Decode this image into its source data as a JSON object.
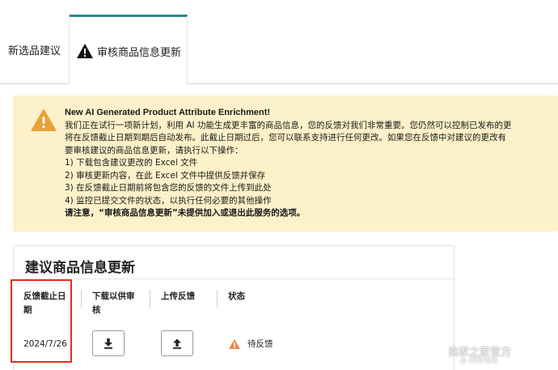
{
  "tabs": [
    {
      "label": "新选品建议"
    },
    {
      "label": "审核商品信息更新"
    }
  ],
  "alert": {
    "title": "New AI Generated Product Attribute Enrichment!",
    "lines": [
      "我们正在试行一项新计划，利用 AI 功能生成更丰富的商品信息，您的反馈对我们非常重要。您仍然可以控制已发布的更",
      "将在反馈截止日期到期后自动发布。此截止日期过后，您可以联系支持进行任何更改。如果您在反馈中对建议的更改有",
      "要审核建议的商品信息更新，请执行以下操作：",
      "1) 下载包含建议更改的 Excel 文件",
      "2) 审核更新内容，在此 Excel 文件中提供反馈并保存",
      "3) 在反馈截止日期前将包含您的反馈的文件上传到此处",
      "4) 监控已提交文件的状态，以执行任何必要的其他操作"
    ],
    "note": "请注意，“审核商品信息更新”未提供加入或退出此服务的选项。"
  },
  "card": {
    "title": "建议商品信息更新",
    "columns": {
      "deadline": "反馈截止日期",
      "download": "下载以供审核",
      "upload": "上传反馈",
      "status": "状态"
    },
    "row": {
      "deadline": "2024/7/26",
      "status": "待反馈"
    }
  },
  "watermark": {
    "text": "卖家之家官方",
    "sub": "@ 跨境电商"
  },
  "colors": {
    "accent_tab": "#26888e",
    "alert_bg": "#fcf1c9",
    "warning": "#e8a13a",
    "highlight": "#d9331f"
  }
}
